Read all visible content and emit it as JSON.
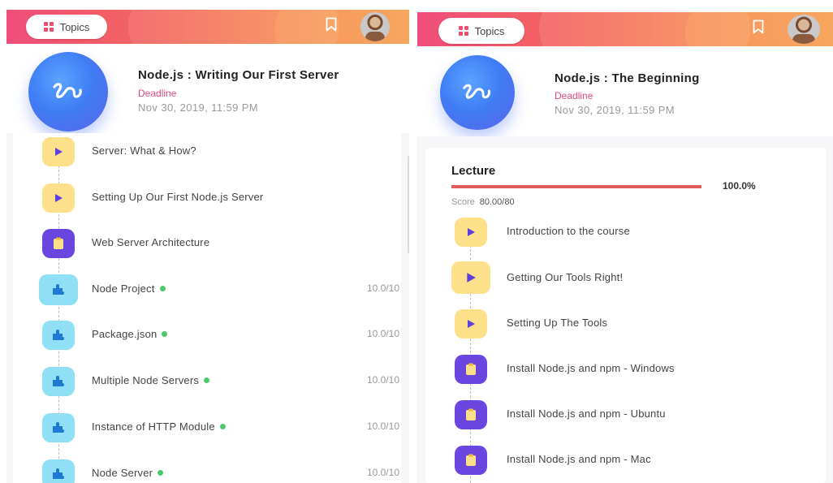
{
  "left": {
    "topics_label": "Topics",
    "course_title": "Node.js : Writing Our First Server",
    "deadline_label": "Deadline",
    "deadline_date": "Nov 30, 2019, 11:59 PM",
    "items": [
      {
        "type": "video-icon",
        "label": "Server: What & How?"
      },
      {
        "type": "video-icon",
        "label": "Setting Up Our First Node.js Server"
      },
      {
        "type": "clipboard-icon",
        "label": "Web Server Architecture"
      },
      {
        "type": "puzzle-icon",
        "label": "Node Project",
        "score": "10.0/10",
        "completed": true
      },
      {
        "type": "puzzle-icon",
        "label": "Package.json",
        "score": "10.0/10",
        "completed": true
      },
      {
        "type": "puzzle-icon",
        "label": "Multiple Node Servers",
        "score": "10.0/10",
        "completed": true
      },
      {
        "type": "puzzle-icon",
        "label": "Instance of HTTP Module",
        "score": "10.0/10",
        "completed": true
      },
      {
        "type": "puzzle-icon",
        "label": "Node Server",
        "score": "10.0/10",
        "completed": true
      }
    ]
  },
  "right": {
    "topics_label": "Topics",
    "course_title": "Node.js : The Beginning",
    "deadline_label": "Deadline",
    "deadline_date": "Nov 30, 2019, 11:59 PM",
    "section_title": "Lecture",
    "progress_percent": 100,
    "progress_label": "100.0%",
    "score_label": "Score",
    "score_value": "80.00/80",
    "items": [
      {
        "type": "video-icon",
        "label": "Introduction to the course"
      },
      {
        "type": "video-icon",
        "label": "Getting Our Tools Right!"
      },
      {
        "type": "video-icon",
        "label": "Setting Up The Tools"
      },
      {
        "type": "clipboard-icon",
        "label": "Install Node.js and npm - Windows"
      },
      {
        "type": "clipboard-icon",
        "label": "Install Node.js and npm - Ubuntu"
      },
      {
        "type": "clipboard-icon",
        "label": "Install Node.js and npm - Mac"
      }
    ]
  },
  "colors": {
    "header_gradient_start": "#ef4e7b",
    "header_gradient_end": "#f5a05a",
    "deadline": "#e24a7a",
    "logo_blue": "#3f7df5",
    "progress": "#e25a5a",
    "completed_dot": "#4cc86a",
    "video_bg": "#fde08a",
    "doc_bg": "#6b45e0",
    "puzzle_bg": "#8fe0f5"
  }
}
